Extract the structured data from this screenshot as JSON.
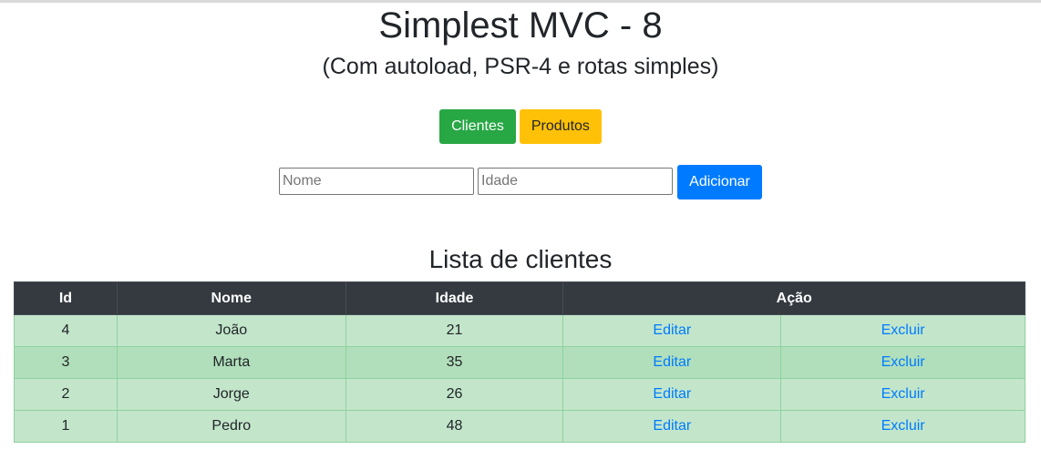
{
  "header": {
    "title": "Simplest MVC - 8",
    "subtitle": "(Com autoload, PSR-4 e rotas simples)"
  },
  "nav": {
    "clientes_label": "Clientes",
    "produtos_label": "Produtos"
  },
  "form": {
    "nome_placeholder": "Nome",
    "idade_placeholder": "Idade",
    "submit_label": "Adicionar"
  },
  "list": {
    "title": "Lista de clientes",
    "columns": [
      "Id",
      "Nome",
      "Idade",
      "Ação"
    ],
    "rows": [
      {
        "id": "4",
        "nome": "João",
        "idade": "21",
        "edit": "Editar",
        "delete": "Excluir"
      },
      {
        "id": "3",
        "nome": "Marta",
        "idade": "35",
        "edit": "Editar",
        "delete": "Excluir"
      },
      {
        "id": "2",
        "nome": "Jorge",
        "idade": "26",
        "edit": "Editar",
        "delete": "Excluir"
      },
      {
        "id": "1",
        "nome": "Pedro",
        "idade": "48",
        "edit": "Editar",
        "delete": "Excluir"
      }
    ]
  },
  "colors": {
    "success": "#28a745",
    "warning": "#ffc107",
    "primary": "#007bff",
    "table_head": "#343a40",
    "row_success": "#c3e6cb",
    "row_success_stripe": "#b1dfbb"
  }
}
